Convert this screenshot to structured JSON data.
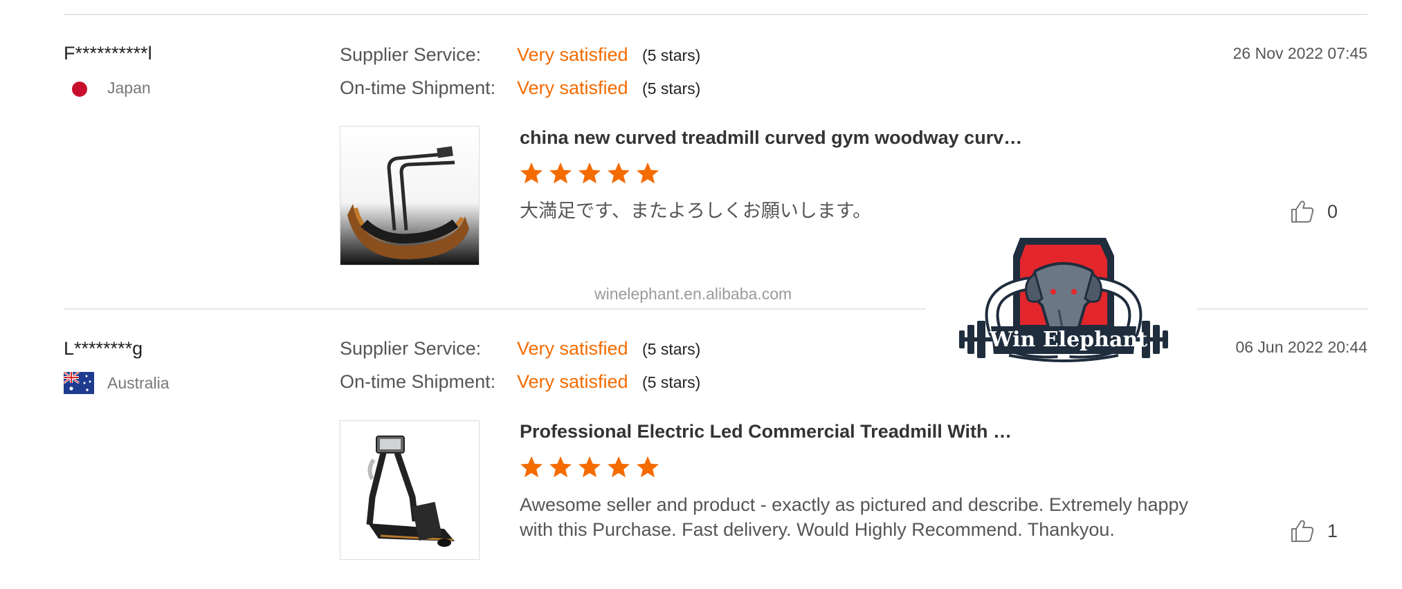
{
  "reviews": [
    {
      "user": "F**********l",
      "country": "Japan",
      "supplier_label": "Supplier Service:",
      "supplier_value": "Very satisfied",
      "supplier_stars": "(5 stars)",
      "shipment_label": "On-time Shipment:",
      "shipment_value": "Very satisfied",
      "shipment_stars": "(5 stars)",
      "date": "26 Nov 2022 07:45",
      "product_title": "china new curved treadmill curved gym woodway curv…",
      "rating": 5,
      "review_text": "大満足です、またよろしくお願いします。",
      "likes": "0"
    },
    {
      "user": "L********g",
      "country": "Australia",
      "supplier_label": "Supplier Service:",
      "supplier_value": "Very satisfied",
      "supplier_stars": "(5 stars)",
      "shipment_label": "On-time Shipment:",
      "shipment_value": "Very satisfied",
      "shipment_stars": "(5 stars)",
      "date": "06 Jun 2022 20:44",
      "product_title": "Professional Electric Led Commercial Treadmill With …",
      "rating": 5,
      "review_text": "Awesome seller and product - exactly as pictured and describe. Extremely happy with this Purchase. Fast delivery. Would Highly Recommend. Thankyou.",
      "likes": "1"
    }
  ],
  "watermark": {
    "url": "winelephant.en.alibaba.com",
    "logo_text": "Win Elephant"
  },
  "colors": {
    "accent": "#f46b00",
    "divider": "#e6e6e6",
    "logo_red": "#e3262b",
    "logo_navy": "#1f2d3d"
  },
  "icons": [
    "thumbs-up-icon",
    "star-icon",
    "japan-flag-icon",
    "australia-flag-icon"
  ]
}
